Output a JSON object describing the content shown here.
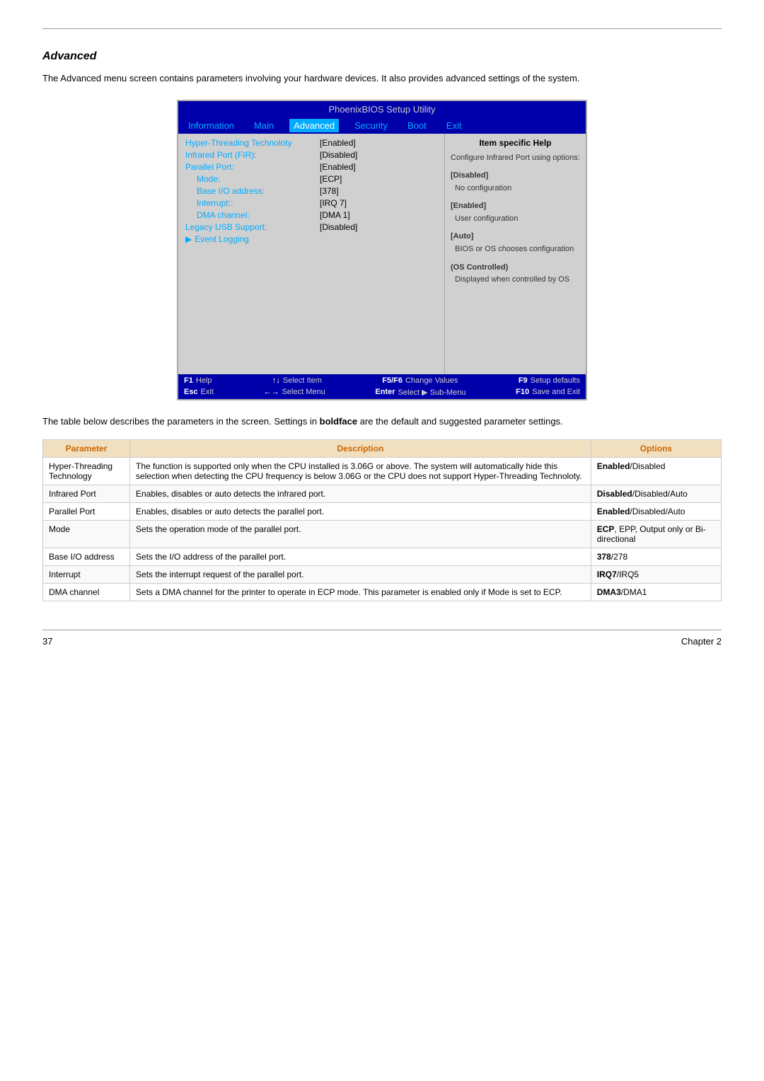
{
  "page": {
    "top_rule": true,
    "section_title": "Advanced",
    "intro_text": "The Advanced menu screen contains parameters involving your hardware devices. It also provides advanced settings of the system.",
    "below_text": "The table below describes the parameters in the screen. Settings in boldface are the default and suggested parameter settings.",
    "footer_left": "37",
    "footer_right": "Chapter 2"
  },
  "bios": {
    "title": "PhoenixBIOS Setup Utility",
    "nav_items": [
      {
        "label": "Information",
        "active": false
      },
      {
        "label": "Main",
        "active": false
      },
      {
        "label": "Advanced",
        "active": true
      },
      {
        "label": "Security",
        "active": false
      },
      {
        "label": "Boot",
        "active": false
      },
      {
        "label": "Exit",
        "active": false
      }
    ],
    "help_title": "Item specific Help",
    "items": [
      {
        "label": "Hyper-Threading Technoloty",
        "value": "[Enabled]",
        "indent": 0,
        "submenu": false
      },
      {
        "label": "Infrared Port (FIR):",
        "value": "[Disabled]",
        "indent": 0,
        "submenu": false
      },
      {
        "label": "Parallel Port:",
        "value": "[Enabled]",
        "indent": 0,
        "submenu": false
      },
      {
        "label": "Mode:",
        "value": "[ECP]",
        "indent": 1,
        "submenu": false
      },
      {
        "label": "Base I/O address:",
        "value": "[378]",
        "indent": 1,
        "submenu": false
      },
      {
        "label": "Interrupt::",
        "value": "[IRQ 7]",
        "indent": 1,
        "submenu": false
      },
      {
        "label": "DMA channel:",
        "value": "[DMA 1]",
        "indent": 1,
        "submenu": false
      },
      {
        "label": "Legacy USB Support:",
        "value": "[Disabled]",
        "indent": 0,
        "submenu": false
      },
      {
        "label": "Event Logging",
        "value": "",
        "indent": 0,
        "submenu": true
      }
    ],
    "help_options": [
      {
        "title": "Configure Infrared Port using options:"
      },
      {
        "title": "[Disabled]",
        "desc": "No configuration"
      },
      {
        "title": "[Enabled]",
        "desc": "User configuration"
      },
      {
        "title": "[Auto]",
        "desc": "BIOS or OS chooses configuration"
      },
      {
        "title": "(OS Controlled)",
        "desc": "Displayed when controlled by OS"
      }
    ],
    "footer_rows": [
      [
        {
          "key": "F1",
          "desc": "Help"
        },
        {
          "key": "↑↓",
          "desc": "Select Item"
        },
        {
          "key": "F5/F6",
          "desc": "Change Values"
        },
        {
          "key": "F9",
          "desc": "Setup defaults"
        }
      ],
      [
        {
          "key": "Esc",
          "desc": "Exit"
        },
        {
          "key": "←→",
          "desc": "Select Menu"
        },
        {
          "key": "Enter",
          "desc": "Select ▶ Sub-Menu"
        },
        {
          "key": "F10",
          "desc": "Save and Exit"
        }
      ]
    ]
  },
  "table": {
    "headers": [
      "Parameter",
      "Description",
      "Options"
    ],
    "rows": [
      {
        "param": "Hyper-Threading Technology",
        "desc": "The function is supported only when the CPU installed is 3.06G or above. The system will automatically hide this selection when detecting the CPU frequency is below 3.06G or the CPU does not support Hyper-Threading Technoloty.",
        "options_bold": "Enabled",
        "options_rest": "/Disabled"
      },
      {
        "param": "Infrared Port",
        "desc": "Enables, disables or auto detects the infrared port.",
        "options_bold": "Disabled",
        "options_rest": "/Disabled/Auto"
      },
      {
        "param": "Parallel Port",
        "desc": "Enables, disables or auto detects the parallel port.",
        "options_bold": "Enabled",
        "options_rest": "/Disabled/Auto"
      },
      {
        "param": "Mode",
        "desc": "Sets the operation mode of the parallel port.",
        "options_bold": "ECP",
        "options_rest": ", EPP, Output only or Bi-directional"
      },
      {
        "param": "Base I/O address",
        "desc": "Sets the I/O address of the parallel port.",
        "options_bold": "378",
        "options_rest": "/278"
      },
      {
        "param": "Interrupt",
        "desc": "Sets the interrupt request of the parallel port.",
        "options_bold": "IRQ7",
        "options_rest": "/IRQ5"
      },
      {
        "param": "DMA channel",
        "desc": "Sets a DMA channel for the printer to operate in ECP mode. This parameter is enabled only if Mode is set to ECP.",
        "options_bold": "DMA3",
        "options_rest": "/DMA1"
      }
    ]
  }
}
